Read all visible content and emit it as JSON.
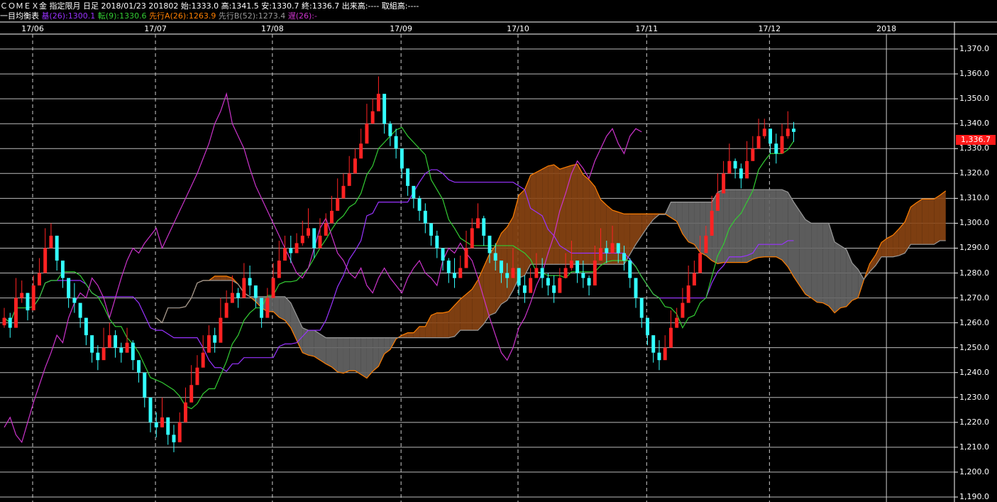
{
  "header": {
    "line1": {
      "instrument": "ＣＯＭＥＸ金 指定限月 日足",
      "date_contract": "2018/01/23 201802",
      "open": "始:1333.0",
      "high": "高:1341.5",
      "low": "安:1330.7",
      "close": "終:1336.7",
      "volume": "出来高:----",
      "open_interest": "取組高:----"
    },
    "line2": {
      "indicator": "一目均衡表",
      "base": "基(26):1300.1",
      "conversion": "転(9):1330.6",
      "span_a": "先行A(26):1263.9",
      "span_b": "先行B(52):1273.4",
      "lagging": "遅(26):-"
    }
  },
  "colors": {
    "base": "#9933ff",
    "conversion": "#33cc33",
    "span_a": "#ff7f00",
    "span_b": "#999999",
    "lagging": "#cc33cc",
    "up_candle": "#ff2222",
    "down_candle": "#33ffff",
    "cloud_bull": "#8b4513",
    "cloud_bear": "#666666",
    "last_price_tag": "#ff1a1a"
  },
  "x_axis": {
    "labels": [
      "17/06",
      "17/07",
      "17/08",
      "17/09",
      "17/10",
      "17/11",
      "17/12",
      "2018"
    ]
  },
  "y_axis": {
    "labels": [
      "1,370.0",
      "1,360.0",
      "1,350.0",
      "1,340.0",
      "1,330.0",
      "1,320.0",
      "1,310.0",
      "1,300.0",
      "1,290.0",
      "1,280.0",
      "1,270.0",
      "1,260.0",
      "1,250.0",
      "1,240.0",
      "1,230.0",
      "1,220.0",
      "1,210.0",
      "1,200.0",
      "1,190.0"
    ]
  },
  "last_price": "1,336.7",
  "chart_data": {
    "type": "candlestick",
    "ylim": [
      1188,
      1376
    ],
    "months": [
      {
        "label": "17/06",
        "start": 0
      },
      {
        "label": "17/07",
        "start": 21
      },
      {
        "label": "17/08",
        "start": 41
      },
      {
        "label": "17/09",
        "start": 63
      },
      {
        "label": "17/10",
        "start": 83
      },
      {
        "label": "17/11",
        "start": 105
      },
      {
        "label": "17/12",
        "start": 126
      },
      {
        "label": "2018",
        "start": 146
      }
    ],
    "closes": [
      1262,
      1258,
      1270,
      1272,
      1265,
      1275,
      1280,
      1290,
      1295,
      1285,
      1278,
      1270,
      1268,
      1262,
      1255,
      1248,
      1245,
      1250,
      1255,
      1250,
      1248,
      1252,
      1245,
      1240,
      1230,
      1220,
      1218,
      1222,
      1215,
      1212,
      1220,
      1228,
      1235,
      1242,
      1248,
      1255,
      1252,
      1262,
      1268,
      1272,
      1270,
      1278,
      1275,
      1270,
      1262,
      1270,
      1278,
      1285,
      1290,
      1288,
      1292,
      1295,
      1298,
      1290,
      1295,
      1300,
      1305,
      1310,
      1315,
      1320,
      1326,
      1332,
      1340,
      1345,
      1352,
      1340,
      1335,
      1330,
      1322,
      1315,
      1310,
      1305,
      1300,
      1295,
      1290,
      1285,
      1280,
      1278,
      1282,
      1290,
      1298,
      1302,
      1295,
      1288,
      1285,
      1280,
      1278,
      1282,
      1275,
      1272,
      1278,
      1282,
      1278,
      1275,
      1272,
      1278,
      1282,
      1285,
      1280,
      1278,
      1275,
      1285,
      1290,
      1288,
      1292,
      1288,
      1285,
      1278,
      1270,
      1262,
      1255,
      1248,
      1245,
      1250,
      1258,
      1262,
      1268,
      1275,
      1280,
      1288,
      1295,
      1305,
      1312,
      1320,
      1325,
      1322,
      1318,
      1325,
      1330,
      1335,
      1338,
      1332,
      1328,
      1335,
      1338,
      1336.7
    ],
    "candles_source_note": ""
  }
}
